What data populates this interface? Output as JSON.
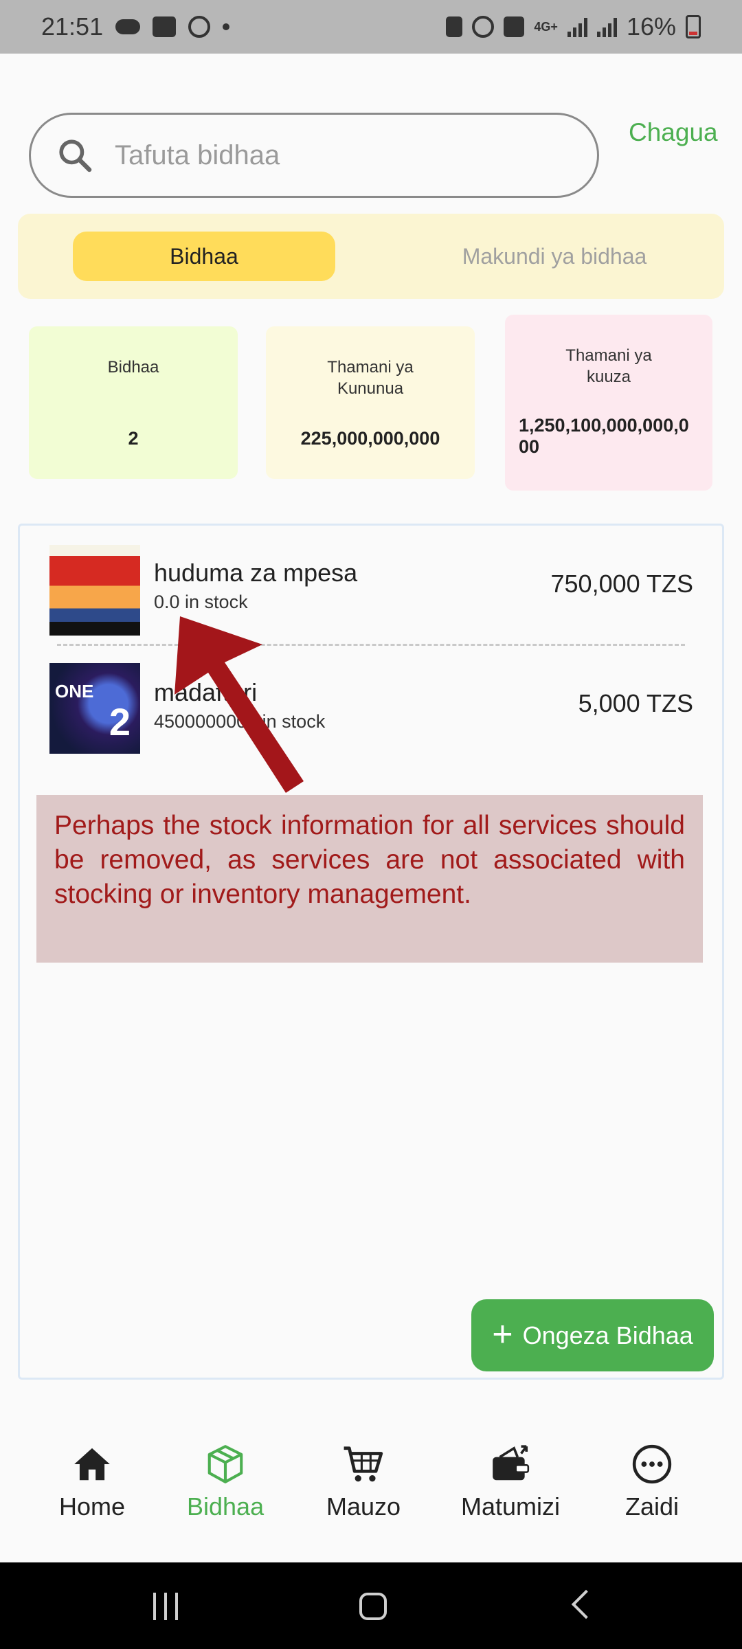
{
  "status_bar": {
    "time": "21:51",
    "network": "4G+",
    "battery": "16%"
  },
  "search": {
    "placeholder": "Tafuta bidhaa",
    "action": "Chagua"
  },
  "tabs": [
    {
      "label": "Bidhaa",
      "active": true
    },
    {
      "label": "Makundi ya bidhaa",
      "active": false
    }
  ],
  "summary": [
    {
      "label": "Bidhaa",
      "value": "2"
    },
    {
      "label": "Thamani ya Kununua",
      "value": "225,000,000,000"
    },
    {
      "label": "Thamani ya kuuza",
      "value": "1,250,100,000,000,000"
    }
  ],
  "products": [
    {
      "name": "huduma za mpesa",
      "stock": "0.0 in stock",
      "price": "750,000 TZS"
    },
    {
      "name": "madaftari",
      "stock": "4500000000 in stock",
      "price": "5,000 TZS"
    }
  ],
  "annotation": {
    "text": "Perhaps the stock information for all services should be removed, as services are not associated with stocking or inventory management.",
    "color": "#a11a1a"
  },
  "fab": {
    "label": "Ongeza Bidhaa",
    "color": "#4caf50"
  },
  "bottom_nav": [
    {
      "label": "Home",
      "icon": "home-icon",
      "active": false
    },
    {
      "label": "Bidhaa",
      "icon": "box-icon",
      "active": true
    },
    {
      "label": "Mauzo",
      "icon": "cart-icon",
      "active": false
    },
    {
      "label": "Matumizi",
      "icon": "wallet-icon",
      "active": false
    },
    {
      "label": "Zaidi",
      "icon": "more-icon",
      "active": false
    }
  ],
  "colors": {
    "accent": "#4caf50",
    "tab_active": "#ffdc5a",
    "tab_bg": "#fbf5d2"
  }
}
